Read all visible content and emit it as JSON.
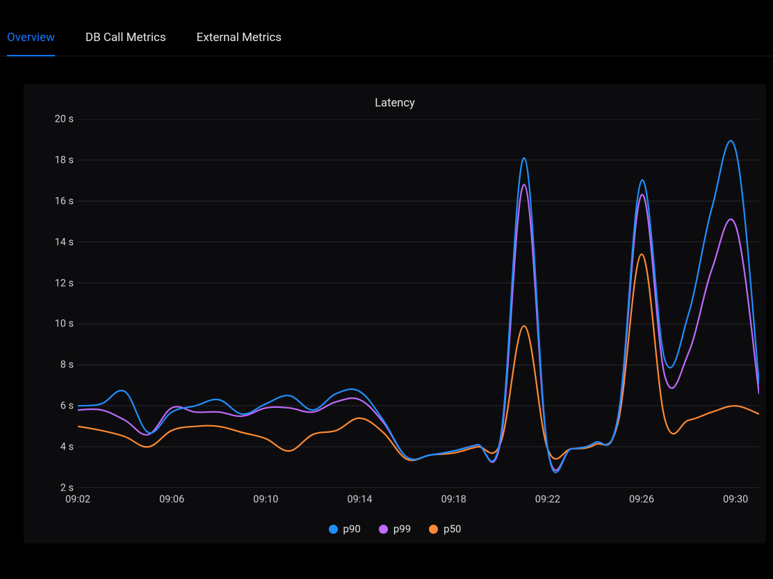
{
  "tabs": [
    {
      "label": "Overview",
      "active": true
    },
    {
      "label": "DB Call Metrics",
      "active": false
    },
    {
      "label": "External Metrics",
      "active": false
    }
  ],
  "chart_data": {
    "type": "line",
    "title": "Latency",
    "xlabel": "",
    "ylabel": "",
    "ylim": [
      2,
      20
    ],
    "y_ticks": [
      2,
      4,
      6,
      8,
      10,
      12,
      14,
      16,
      18,
      20
    ],
    "y_tick_labels": [
      "2 s",
      "4 s",
      "6 s",
      "8 s",
      "10 s",
      "12 s",
      "14 s",
      "16 s",
      "18 s",
      "20 s"
    ],
    "x_tick_values": [
      "09:02",
      "09:06",
      "09:10",
      "09:14",
      "09:18",
      "09:22",
      "09:26",
      "09:30"
    ],
    "x": [
      "09:02",
      "09:03",
      "09:04",
      "09:05",
      "09:06",
      "09:07",
      "09:08",
      "09:09",
      "09:10",
      "09:11",
      "09:12",
      "09:13",
      "09:14",
      "09:15",
      "09:16",
      "09:17",
      "09:18",
      "09:19",
      "09:20",
      "09:21",
      "09:22",
      "09:23",
      "09:24",
      "09:25",
      "09:26",
      "09:27",
      "09:28",
      "09:29",
      "09:30",
      "09:31"
    ],
    "series": [
      {
        "name": "p90",
        "color": "#1f8fff",
        "values": [
          6.0,
          6.1,
          6.7,
          4.7,
          5.7,
          6.0,
          6.3,
          5.6,
          6.1,
          6.5,
          5.8,
          6.6,
          6.7,
          5.3,
          3.5,
          3.6,
          3.8,
          4.1,
          4.5,
          18.1,
          3.9,
          3.9,
          4.2,
          5.5,
          17.0,
          8.2,
          10.5,
          15.7,
          18.5,
          7.1
        ]
      },
      {
        "name": "p99",
        "color": "#c06bff",
        "values": [
          5.8,
          5.8,
          5.3,
          4.6,
          5.9,
          5.7,
          5.7,
          5.5,
          5.9,
          5.9,
          5.7,
          6.2,
          6.3,
          5.2,
          3.5,
          3.6,
          3.8,
          4.1,
          4.3,
          16.8,
          3.9,
          3.9,
          4.2,
          5.4,
          16.3,
          7.4,
          8.6,
          12.7,
          14.8,
          6.6
        ]
      },
      {
        "name": "p50",
        "color": "#ff8a33",
        "values": [
          5.0,
          4.8,
          4.5,
          4.0,
          4.8,
          5.0,
          5.0,
          4.7,
          4.4,
          3.8,
          4.6,
          4.8,
          5.4,
          4.7,
          3.4,
          3.6,
          3.7,
          4.0,
          4.2,
          9.9,
          3.9,
          3.9,
          4.1,
          5.2,
          13.4,
          5.3,
          5.3,
          5.7,
          6.0,
          5.6
        ]
      }
    ],
    "legend_order": [
      "p90",
      "p99",
      "p50"
    ]
  }
}
